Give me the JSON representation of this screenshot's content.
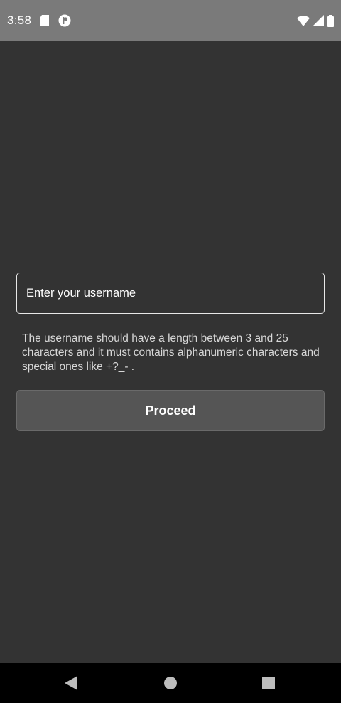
{
  "status_bar": {
    "time": "3:58",
    "icons": [
      "sd-card-icon",
      "notification-icon",
      "wifi-icon",
      "signal-icon",
      "battery-icon"
    ]
  },
  "form": {
    "username_placeholder": "Enter your username",
    "username_value": "",
    "hint": "The username should have a length between 3 and 25 characters and it must contains alphanumeric characters and special ones like +?_- .",
    "proceed_label": "Proceed"
  },
  "nav_bar": {
    "buttons": [
      "back-icon",
      "home-icon",
      "recents-icon"
    ]
  },
  "colors": {
    "background": "#333333",
    "status_bar": "#7a7a7a",
    "button_fill": "#555555",
    "nav_bar": "#000000"
  }
}
